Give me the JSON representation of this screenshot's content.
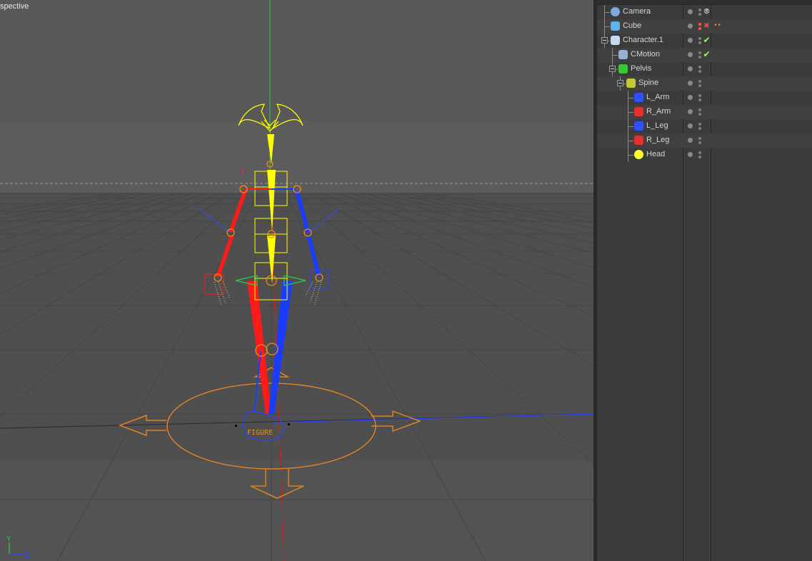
{
  "viewport": {
    "label": "spective",
    "axis_y": "Y",
    "axis_z": "Z",
    "figure_label": "FIGURE"
  },
  "object_manager": {
    "objects": [
      {
        "name": "Camera",
        "icon": "camera-icon",
        "depth": 0,
        "expander": false,
        "flag": "camera-tag-icon"
      },
      {
        "name": "Cube",
        "icon": "cube-icon",
        "depth": 0,
        "expander": false,
        "flag": "disabled-x-icon",
        "extra_tag": "material-tag-icon"
      },
      {
        "name": "Character.1",
        "icon": "character-icon",
        "depth": 0,
        "expander": true,
        "flag": "enabled-check-icon"
      },
      {
        "name": "CMotion",
        "icon": "cmotion-icon",
        "depth": 1,
        "expander": false,
        "flag": "enabled-check-icon"
      },
      {
        "name": "Pelvis",
        "icon": "pelvis-icon",
        "depth": 1,
        "expander": true,
        "flag": ""
      },
      {
        "name": "Spine",
        "icon": "spine-icon",
        "depth": 2,
        "expander": true,
        "flag": ""
      },
      {
        "name": "L_Arm",
        "icon": "left-arm-icon",
        "depth": 3,
        "expander": false,
        "flag": ""
      },
      {
        "name": "R_Arm",
        "icon": "right-arm-icon",
        "depth": 3,
        "expander": false,
        "flag": ""
      },
      {
        "name": "L_Leg",
        "icon": "left-leg-icon",
        "depth": 3,
        "expander": false,
        "flag": ""
      },
      {
        "name": "R_Leg",
        "icon": "right-leg-icon",
        "depth": 3,
        "expander": false,
        "flag": ""
      },
      {
        "name": "Head",
        "icon": "head-icon",
        "depth": 3,
        "expander": false,
        "flag": ""
      }
    ]
  },
  "colors": {
    "viewport_bg": "#535353",
    "panel_bg": "#3b3b3b",
    "rig_yellow": "#ffff00",
    "rig_red": "#ff1a1a",
    "rig_blue": "#1a3cff",
    "rig_orange": "#f08a1c",
    "axis_green": "#2ecc40",
    "check_green": "#8fff5a",
    "x_red": "#ff4040"
  }
}
